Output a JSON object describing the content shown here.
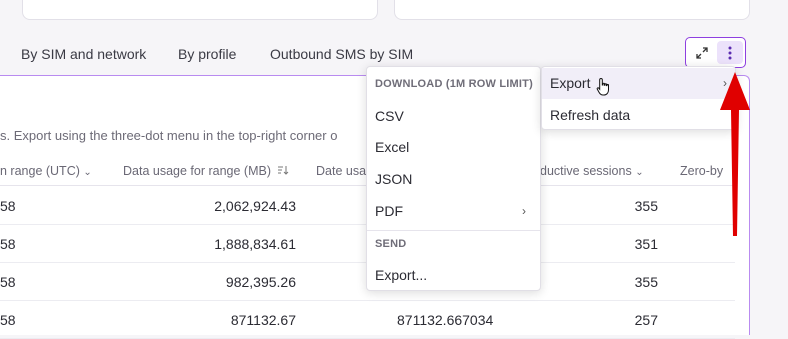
{
  "tabs": [
    "By SIM and network",
    "By profile",
    "Outbound SMS by SIM"
  ],
  "description": "s. Export using the three-dot menu in the top-right corner o",
  "columns": [
    "n range (UTC)",
    "Data usage for range (MB)",
    "Date usa",
    "ductive sessions",
    "Zero-by"
  ],
  "rows": [
    {
      "c0": "58",
      "c1": "2,062,924.43",
      "c2": "355"
    },
    {
      "c0": "58",
      "c1": "1,888,834.61",
      "c2": "351"
    },
    {
      "c0": "58",
      "c1": "982,395.26",
      "c2": "355"
    },
    {
      "c0": "58",
      "c1": "871132.67",
      "c_mid": "871132.667034",
      "c2": "257"
    }
  ],
  "download_menu": {
    "download_header": "DOWNLOAD (1M ROW LIMIT)",
    "items": [
      "CSV",
      "Excel",
      "JSON",
      "PDF"
    ],
    "send_header": "SEND",
    "send_item": "Export..."
  },
  "actions_menu": {
    "export": "Export",
    "refresh": "Refresh data"
  },
  "icons": {
    "expand": "expand-icon",
    "more": "more-vertical-icon",
    "sort": "sort-icon",
    "cursor": "hand-cursor-icon",
    "arrow": "red-annotation-arrow"
  },
  "colors": {
    "accent": "#8e3fe0",
    "annotation": "#e00000"
  }
}
